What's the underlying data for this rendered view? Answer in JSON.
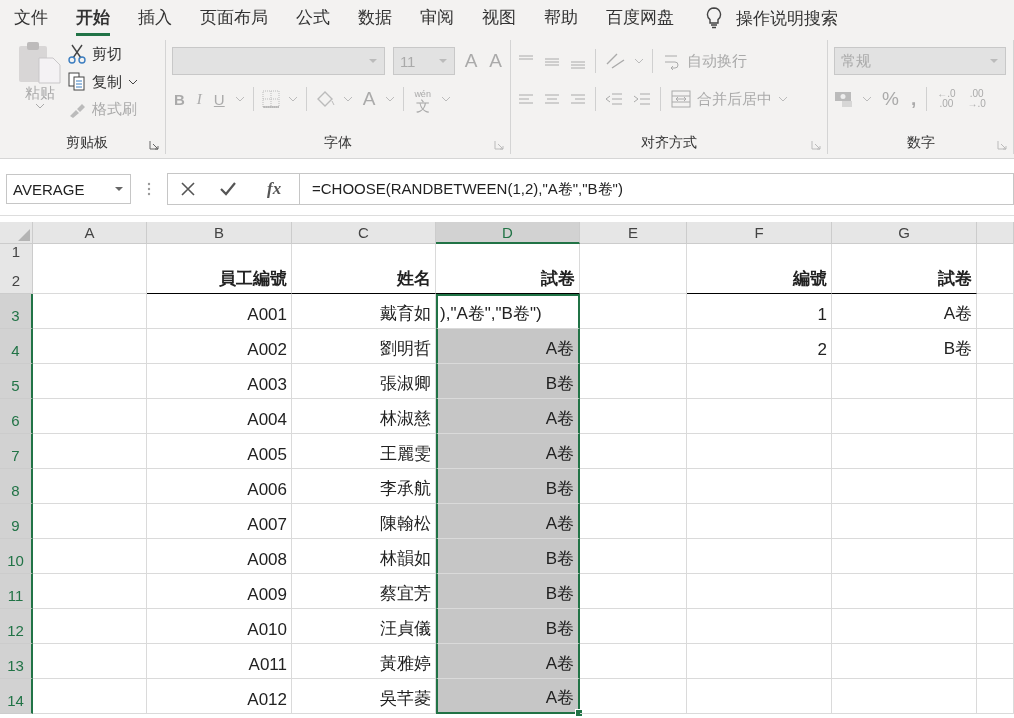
{
  "tabs": [
    {
      "label": "文件",
      "selected": false
    },
    {
      "label": "开始",
      "selected": true
    },
    {
      "label": "插入",
      "selected": false
    },
    {
      "label": "页面布局",
      "selected": false
    },
    {
      "label": "公式",
      "selected": false
    },
    {
      "label": "数据",
      "selected": false
    },
    {
      "label": "审阅",
      "selected": false
    },
    {
      "label": "视图",
      "selected": false
    },
    {
      "label": "帮助",
      "selected": false
    },
    {
      "label": "百度网盘",
      "selected": false
    }
  ],
  "tell_me": "操作说明搜索",
  "ribbon": {
    "clipboard": {
      "label": "剪贴板",
      "paste": {
        "label": "粘贴",
        "disabled": true
      },
      "cut": {
        "label": "剪切",
        "disabled": false
      },
      "copy": {
        "label": "复制",
        "disabled": false
      },
      "format_painter": {
        "label": "格式刷",
        "disabled": true
      }
    },
    "font": {
      "label": "字体",
      "disabled": true,
      "size": "11",
      "grow": "A",
      "shrink": "A",
      "bold": "B",
      "italic": "I",
      "underline": "U",
      "font_color": "A",
      "phonetic_top": "wén",
      "phonetic": "文"
    },
    "alignment": {
      "label": "对齐方式",
      "disabled": true,
      "wrap": "自动换行",
      "merge": "合并后居中"
    },
    "number": {
      "label": "数字",
      "disabled": true,
      "format": "常规",
      "percent": "%",
      "comma": ",",
      "increase_decimal": [
        "←.0",
        ".00"
      ],
      "decrease_decimal": [
        ".00",
        "→.0"
      ]
    }
  },
  "formula_bar": {
    "name_box": "AVERAGE",
    "function_label": "fx",
    "formula": "=CHOOSE(RANDBETWEEN(1,2),\"A卷\",\"B卷\")"
  },
  "columns": [
    {
      "label": "A",
      "selected": false
    },
    {
      "label": "B",
      "selected": false
    },
    {
      "label": "C",
      "selected": false
    },
    {
      "label": "D",
      "selected": true
    },
    {
      "label": "E",
      "selected": false
    },
    {
      "label": "F",
      "selected": false
    },
    {
      "label": "G",
      "selected": false
    }
  ],
  "rows": [
    {
      "number": "1",
      "kind": "blank",
      "selected": false,
      "active": false,
      "cells": {}
    },
    {
      "number": "2",
      "kind": "header",
      "selected": false,
      "active": false,
      "cells": {
        "b": "員工編號",
        "c": "姓名",
        "d": "試卷",
        "f": "編號",
        "g": "試卷"
      }
    },
    {
      "number": "3",
      "kind": "data",
      "selected": true,
      "active": true,
      "cells": {
        "b": "A001",
        "c": "戴育如",
        "d": "),\"A卷\",\"B卷\")",
        "f": "1",
        "g": "A卷"
      }
    },
    {
      "number": "4",
      "kind": "data",
      "selected": true,
      "active": false,
      "cells": {
        "b": "A002",
        "c": "劉明哲",
        "d": "A卷",
        "f": "2",
        "g": "B卷"
      }
    },
    {
      "number": "5",
      "kind": "data",
      "selected": true,
      "active": false,
      "cells": {
        "b": "A003",
        "c": "張淑卿",
        "d": "B卷"
      }
    },
    {
      "number": "6",
      "kind": "data",
      "selected": true,
      "active": false,
      "cells": {
        "b": "A004",
        "c": "林淑慈",
        "d": "A卷"
      }
    },
    {
      "number": "7",
      "kind": "data",
      "selected": true,
      "active": false,
      "cells": {
        "b": "A005",
        "c": "王麗雯",
        "d": "A卷"
      }
    },
    {
      "number": "8",
      "kind": "data",
      "selected": true,
      "active": false,
      "cells": {
        "b": "A006",
        "c": "李承航",
        "d": "B卷"
      }
    },
    {
      "number": "9",
      "kind": "data",
      "selected": true,
      "active": false,
      "cells": {
        "b": "A007",
        "c": "陳翰松",
        "d": "A卷"
      }
    },
    {
      "number": "10",
      "kind": "data",
      "selected": true,
      "active": false,
      "cells": {
        "b": "A008",
        "c": "林韻如",
        "d": "B卷"
      }
    },
    {
      "number": "11",
      "kind": "data",
      "selected": true,
      "active": false,
      "cells": {
        "b": "A009",
        "c": "蔡宜芳",
        "d": "B卷"
      }
    },
    {
      "number": "12",
      "kind": "data",
      "selected": true,
      "active": false,
      "cells": {
        "b": "A010",
        "c": "汪貞儀",
        "d": "B卷"
      }
    },
    {
      "number": "13",
      "kind": "data",
      "selected": true,
      "active": false,
      "cells": {
        "b": "A011",
        "c": "黃雅婷",
        "d": "A卷"
      }
    },
    {
      "number": "14",
      "kind": "data",
      "selected": true,
      "active": false,
      "cells": {
        "b": "A012",
        "c": "吳芊菱",
        "d": "A卷"
      }
    }
  ]
}
